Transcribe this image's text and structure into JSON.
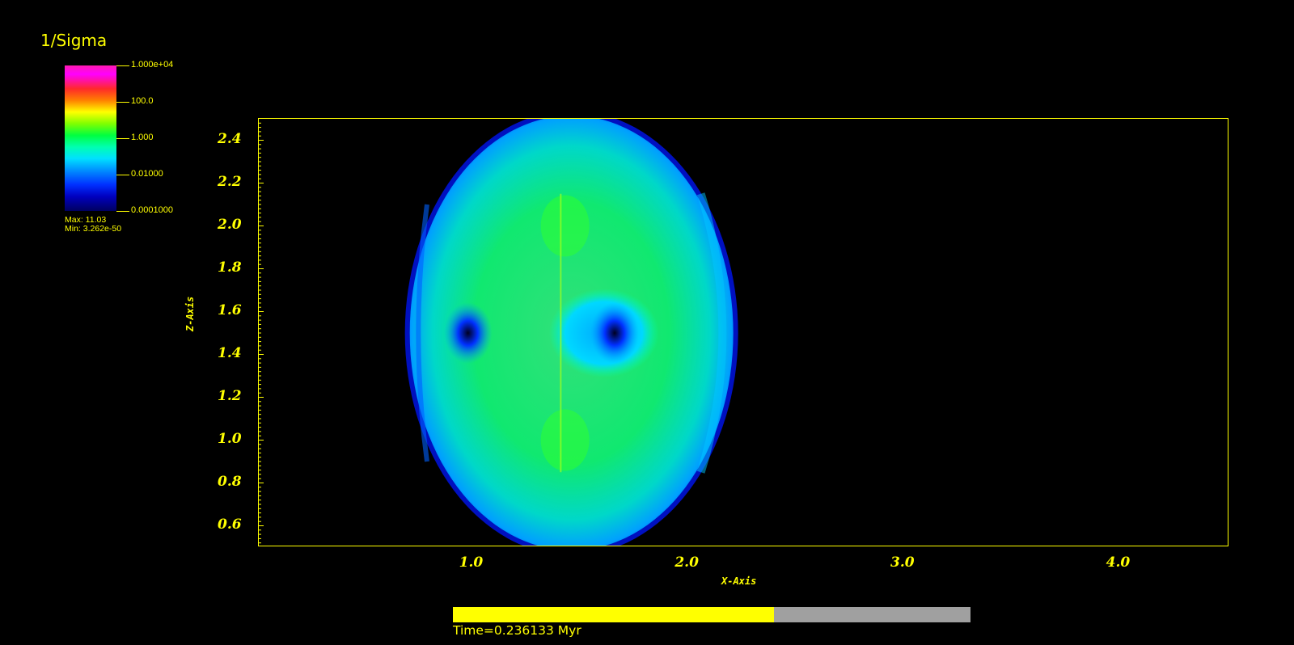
{
  "colorbar": {
    "title": "1/Sigma",
    "ticks": [
      "1.000e+04",
      "100.0",
      "1.000",
      "0.01000",
      "0.0001000"
    ],
    "max_label": "Max:  11.03",
    "min_label": "Min:  3.262e-50"
  },
  "chart_data": {
    "type": "heatmap",
    "xlabel": "X-Axis",
    "ylabel": "Z-Axis",
    "xlim": [
      0.0,
      4.5
    ],
    "ylim": [
      0.5,
      2.5
    ],
    "xticks": [
      "1.0",
      "2.0",
      "3.0",
      "4.0"
    ],
    "xtick_values": [
      1.0,
      2.0,
      3.0,
      4.0
    ],
    "yticks": [
      "0.6",
      "0.8",
      "1.0",
      "1.2",
      "1.4",
      "1.6",
      "1.8",
      "2.0",
      "2.2",
      "2.4"
    ],
    "ytick_values": [
      0.6,
      0.8,
      1.0,
      1.2,
      1.4,
      1.6,
      1.8,
      2.0,
      2.2,
      2.4
    ],
    "colormap": "hot_desaturated rainbow (log scale)",
    "color_scale": "log",
    "value_range": [
      0.0001,
      10000
    ],
    "field_extent_x": [
      0.7,
      2.2
    ],
    "field_extent_z": [
      0.5,
      2.5
    ],
    "nulls": [
      {
        "x": 0.97,
        "z": 1.5
      },
      {
        "x": 1.65,
        "z": 1.5
      }
    ]
  },
  "time": {
    "label": "Time=0.236133 Myr",
    "progress": 0.62
  }
}
